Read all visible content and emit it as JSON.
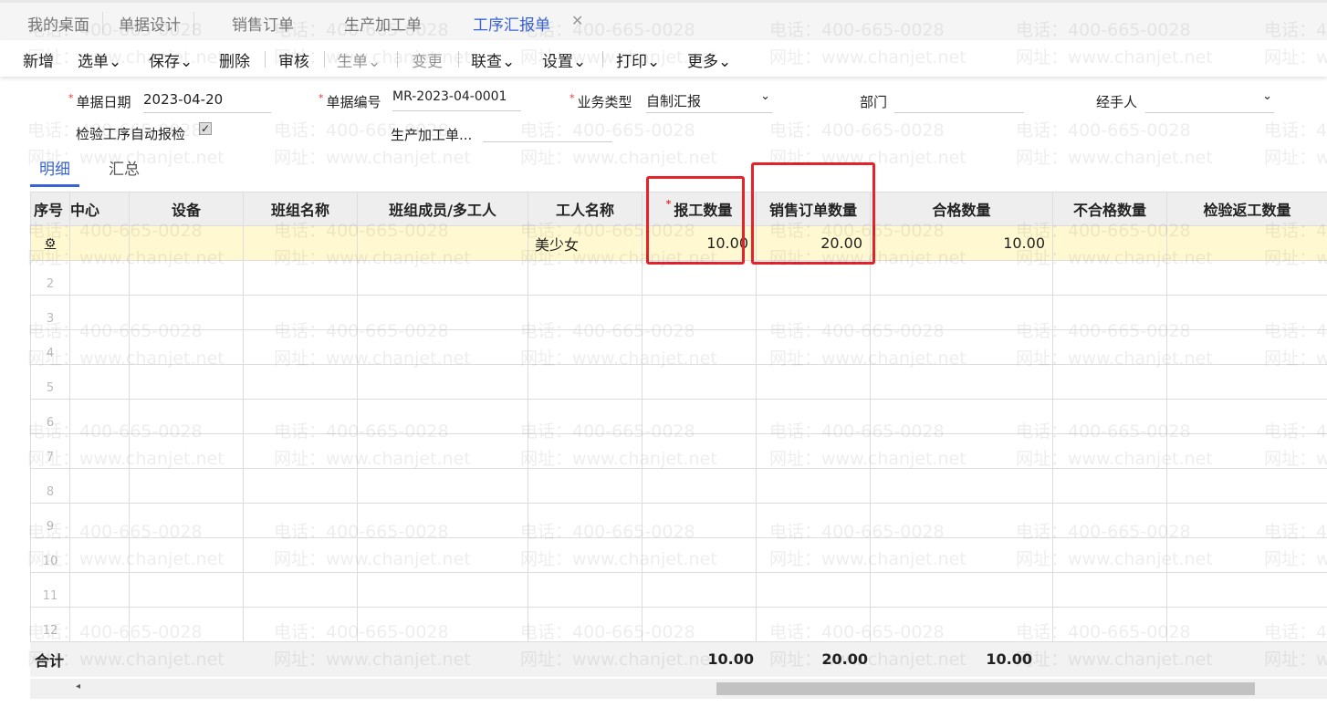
{
  "tabs": [
    {
      "label": "我的桌面"
    },
    {
      "label": "单据设计"
    },
    {
      "label": "销售订单"
    },
    {
      "label": "生产加工单"
    },
    {
      "label": "工序汇报单",
      "active": true
    }
  ],
  "toolbar": [
    "新增",
    "选单",
    "保存",
    "删除",
    "审核",
    "生单",
    "变更",
    "联查",
    "设置",
    "打印",
    "更多"
  ],
  "form": {
    "date_label": "单据日期",
    "date": "2023-04-20",
    "code_label": "单据编号",
    "code": "MR-2023-04-0001",
    "type_label": "业务类型",
    "type": "自制汇报",
    "dept_label": "部门",
    "handler_label": "经手人",
    "auto_check_label": "检验工序自动报检",
    "prod_order_label": "生产加工单..."
  },
  "subtabs": [
    "明细",
    "汇总"
  ],
  "grid": {
    "columns": [
      "序号",
      "中心",
      "设备",
      "班组名称",
      "班组成员/多工人",
      "工人名称",
      "报工数量",
      "销售订单数量",
      "合格数量",
      "不合格数量",
      "检验返工数量"
    ],
    "row1": {
      "worker": "美少女",
      "report_qty": "10.00",
      "sales_qty": "20.00",
      "pass_qty": "10.00"
    },
    "row_numbers": [
      "2",
      "3",
      "4",
      "5",
      "6",
      "7",
      "8",
      "9",
      "10",
      "11",
      "12"
    ],
    "total": {
      "label": "合计",
      "report_qty": "10.00",
      "sales_qty": "20.00",
      "pass_qty": "10.00"
    }
  },
  "watermark": {
    "phone": "电话：400-665-0028",
    "site": "网址：www.chanjet.net"
  },
  "colors": {
    "accent": "#3a63d6",
    "highlight": "#e5232b"
  }
}
